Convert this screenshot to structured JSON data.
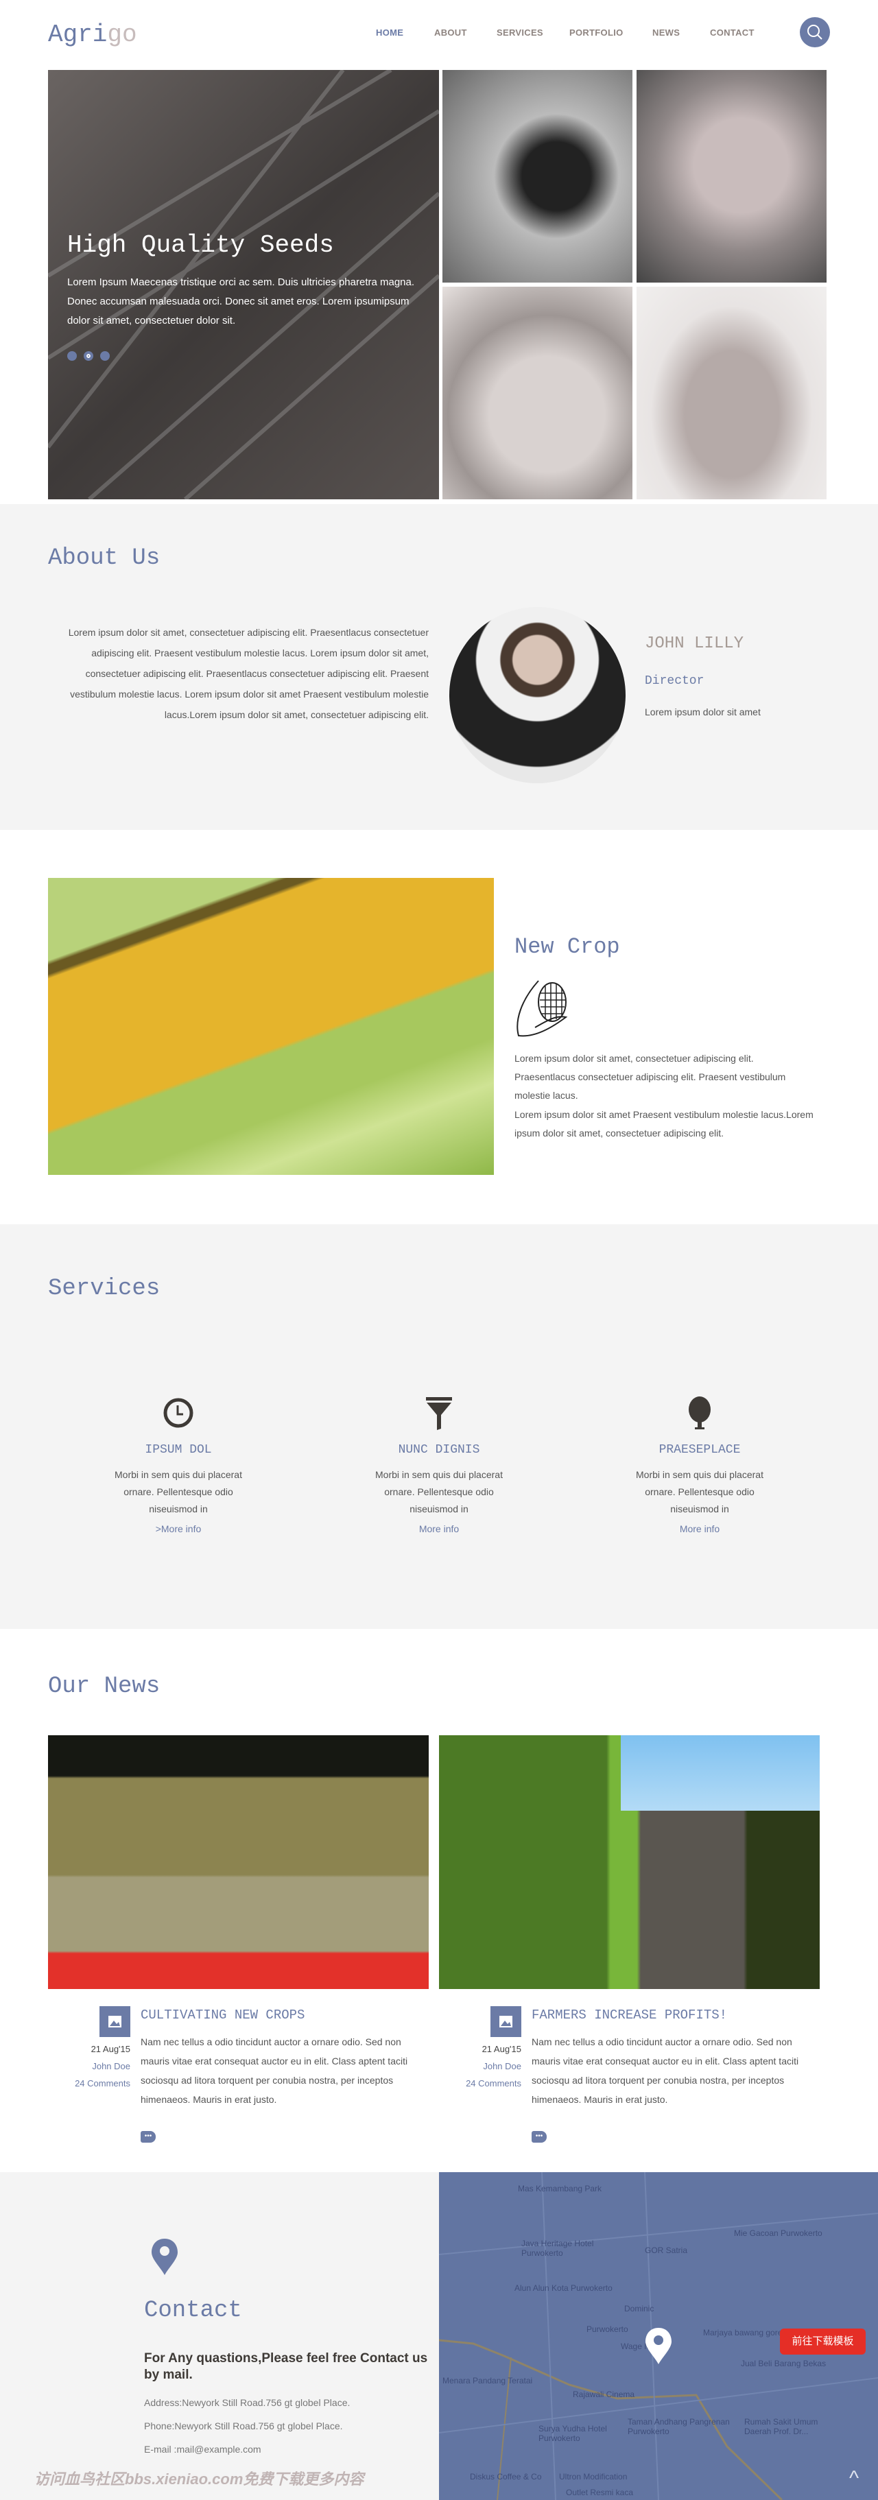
{
  "header": {
    "logo_a": "Agri",
    "logo_b": "go",
    "nav": [
      "HOME",
      "ABOUT",
      "SERVICES",
      "PORTFOLIO",
      "NEWS",
      "CONTACT"
    ],
    "search_icon": "search-icon"
  },
  "hero": {
    "title": "High Quality Seeds",
    "text": "Lorem Ipsum Maecenas tristique orci ac sem. Duis ultricies pharetra magna. Donec accumsan malesuada orci. Donec sit amet eros. Lorem ipsumipsum dolor sit amet, consectetuer dolor sit.",
    "slides": 3,
    "active_slide": 2
  },
  "about": {
    "title": "About Us",
    "text": "Lorem ipsum dolor sit amet, consectetuer adipiscing elit. Praesentlacus consectetuer adipiscing elit. Praesent vestibulum molestie lacus. Lorem ipsum dolor sit amet, consectetuer adipiscing elit. Praesentlacus consectetuer adipiscing elit. Praesent vestibulum molestie lacus. Lorem ipsum dolor sit amet Praesent vestibulum molestie lacus.Lorem ipsum dolor sit amet, consectetuer adipiscing elit.",
    "name": "JOHN LILLY",
    "role": "Director",
    "bio": "Lorem ipsum dolor sit amet"
  },
  "crop": {
    "title": "New Crop",
    "icon": "corn-icon",
    "p1": "Lorem ipsum dolor sit amet, consectetuer adipiscing elit. Praesentlacus consectetuer adipiscing elit. Praesent vestibulum molestie lacus.",
    "p2": "Lorem ipsum dolor sit amet Praesent vestibulum molestie lacus.Lorem ipsum dolor sit amet, consectetuer adipiscing elit."
  },
  "services": {
    "title": "Services",
    "items": [
      {
        "icon": "clock-icon",
        "title": "IPSUM DOL",
        "text": "Morbi in sem quis dui placerat ornare. Pellentesque odio niseuismod in",
        "link": ">More info"
      },
      {
        "icon": "funnel-icon",
        "title": "NUNC DIGNIS",
        "text": "Morbi in sem quis dui placerat ornare. Pellentesque odio niseuismod in",
        "link": "More info"
      },
      {
        "icon": "tree-icon",
        "title": "PRAESEPLACE",
        "text": "Morbi in sem quis dui placerat ornare. Pellentesque odio niseuismod in",
        "link": "More info"
      }
    ]
  },
  "news": {
    "title": "Our News",
    "posts": [
      {
        "title": "CULTIVATING NEW CROPS",
        "date": "21 Aug'15",
        "author": "John Doe",
        "comments": "24 Comments",
        "text": "Nam nec tellus a odio tincidunt auctor a ornare odio. Sed non mauris vitae erat consequat auctor eu in elit. Class aptent taciti sociosqu ad litora torquent per conubia nostra, per inceptos himenaeos. Mauris in erat justo.",
        "more": "•••"
      },
      {
        "title": "FARMERS INCREASE PROFITS!",
        "date": "21 Aug'15",
        "author": "John Doe",
        "comments": "24 Comments",
        "text": "Nam nec tellus a odio tincidunt auctor a ornare odio. Sed non mauris vitae erat consequat auctor eu in elit. Class aptent taciti sociosqu ad litora torquent per conubia nostra, per inceptos himenaeos. Mauris in erat justo.",
        "more": "•••"
      }
    ]
  },
  "contact": {
    "title": "Contact",
    "heading": "For Any quastions,Please feel free Contact us by mail.",
    "address": "Address:Newyork Still Road.756 gt globel Place.",
    "phone": "Phone:Newyork Still Road.756 gt globel Place.",
    "email": "E-mail :mail@example.com"
  },
  "map": {
    "labels": [
      "Mas Kemambang Park",
      "Java Heritage Hotel Purwokerto",
      "GOR Satria",
      "Mie Gacoan Purwokerto",
      "Alun Alun Kota Purwokerto",
      "Dominic",
      "Purwokerto",
      "Wage Market",
      "Marjaya bawang goreng",
      "Jual Beli Barang Bekas",
      "Menara Pandang Teratai",
      "Rajawali Cinema",
      "Taman Andhang Pangrenan Purwokerto",
      "Surya Yudha Hotel Purwokerto",
      "Rumah Sakit Umum Daerah Prof. Dr...",
      "Diskus Coffee & Co",
      "Ultron Modification",
      "Outlet Resmi kaca"
    ]
  },
  "footer": {
    "watermark": "访问血鸟社区bbs.xieniao.com免费下载更多内容",
    "download_button": "前往下载模板",
    "scroll_top": "^"
  },
  "colors": {
    "accent": "#6b7ba6",
    "section_bg": "#f4f4f4",
    "map_bg": "#6275a2",
    "download": "#e52e26"
  }
}
